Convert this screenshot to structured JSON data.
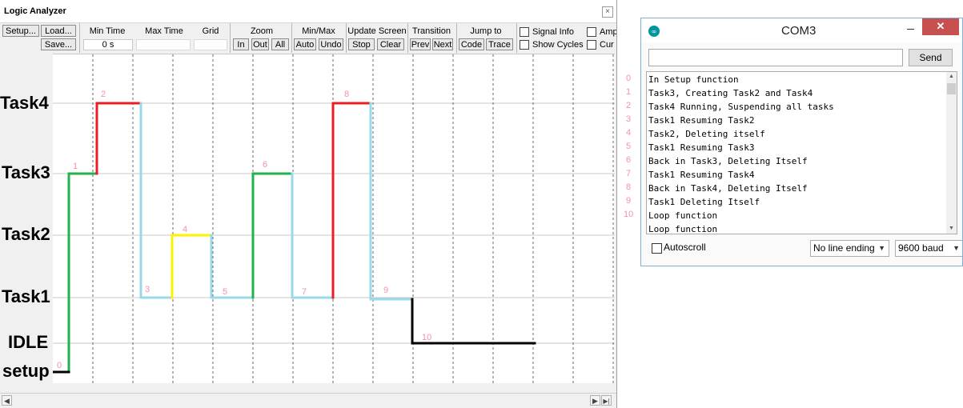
{
  "logic_analyzer": {
    "title": "Logic Analyzer",
    "close_glyph": "×",
    "toolbar": {
      "setup": "Setup...",
      "load": "Load...",
      "save": "Save...",
      "min_time_label": "Min Time",
      "min_time_value": "0 s",
      "max_time_label": "Max Time",
      "grid_label": "Grid",
      "zoom_label": "Zoom",
      "zoom_in": "In",
      "zoom_out": "Out",
      "zoom_all": "All",
      "minmax_label": "Min/Max",
      "auto": "Auto",
      "undo": "Undo",
      "update_label": "Update Screen",
      "stop": "Stop",
      "clear": "Clear",
      "transition_label": "Transition",
      "prev": "Prev",
      "next": "Next",
      "jump_label": "Jump to",
      "code": "Code",
      "trace": "Trace",
      "signal_info": "Signal Info",
      "show_cycles": "Show Cycles",
      "amp_partial": "Amp",
      "cur_partial": "Cur"
    },
    "task_labels": [
      "Task4",
      "Task3",
      "Task2",
      "Task1",
      "IDLE",
      "setup"
    ],
    "step_numbers": [
      "0",
      "1",
      "2",
      "3",
      "4",
      "5",
      "6",
      "7",
      "8",
      "9",
      "10"
    ],
    "colors": {
      "green": "#22b14c",
      "red": "#ed1c24",
      "lightblue": "#99d9ea",
      "yellow": "#fff200",
      "black": "#000000",
      "label_pink": "#f48fb1",
      "grid": "#c8c8c8"
    }
  },
  "serial_monitor": {
    "title": "COM3",
    "close_glyph": "✕",
    "send_label": "Send",
    "input_value": "",
    "lines": [
      "In Setup function",
      "Task3, Creating Task2 and Task4",
      "Task4 Running, Suspending all tasks",
      "Task1 Resuming Task2",
      "Task2, Deleting itself",
      "Task1 Resuming Task3",
      "Back in Task3, Deleting Itself",
      "Task1 Resuming Task4",
      "Back in Task4, Deleting Itself",
      "Task1 Deleting Itself",
      "Loop function",
      "Loop function"
    ],
    "line_numbers": [
      "0",
      "1",
      "2",
      "3",
      "4",
      "5",
      "6",
      "7",
      "8",
      "9",
      "10"
    ],
    "autoscroll_label": "Autoscroll",
    "line_ending": "No line ending",
    "baud": "9600 baud"
  }
}
